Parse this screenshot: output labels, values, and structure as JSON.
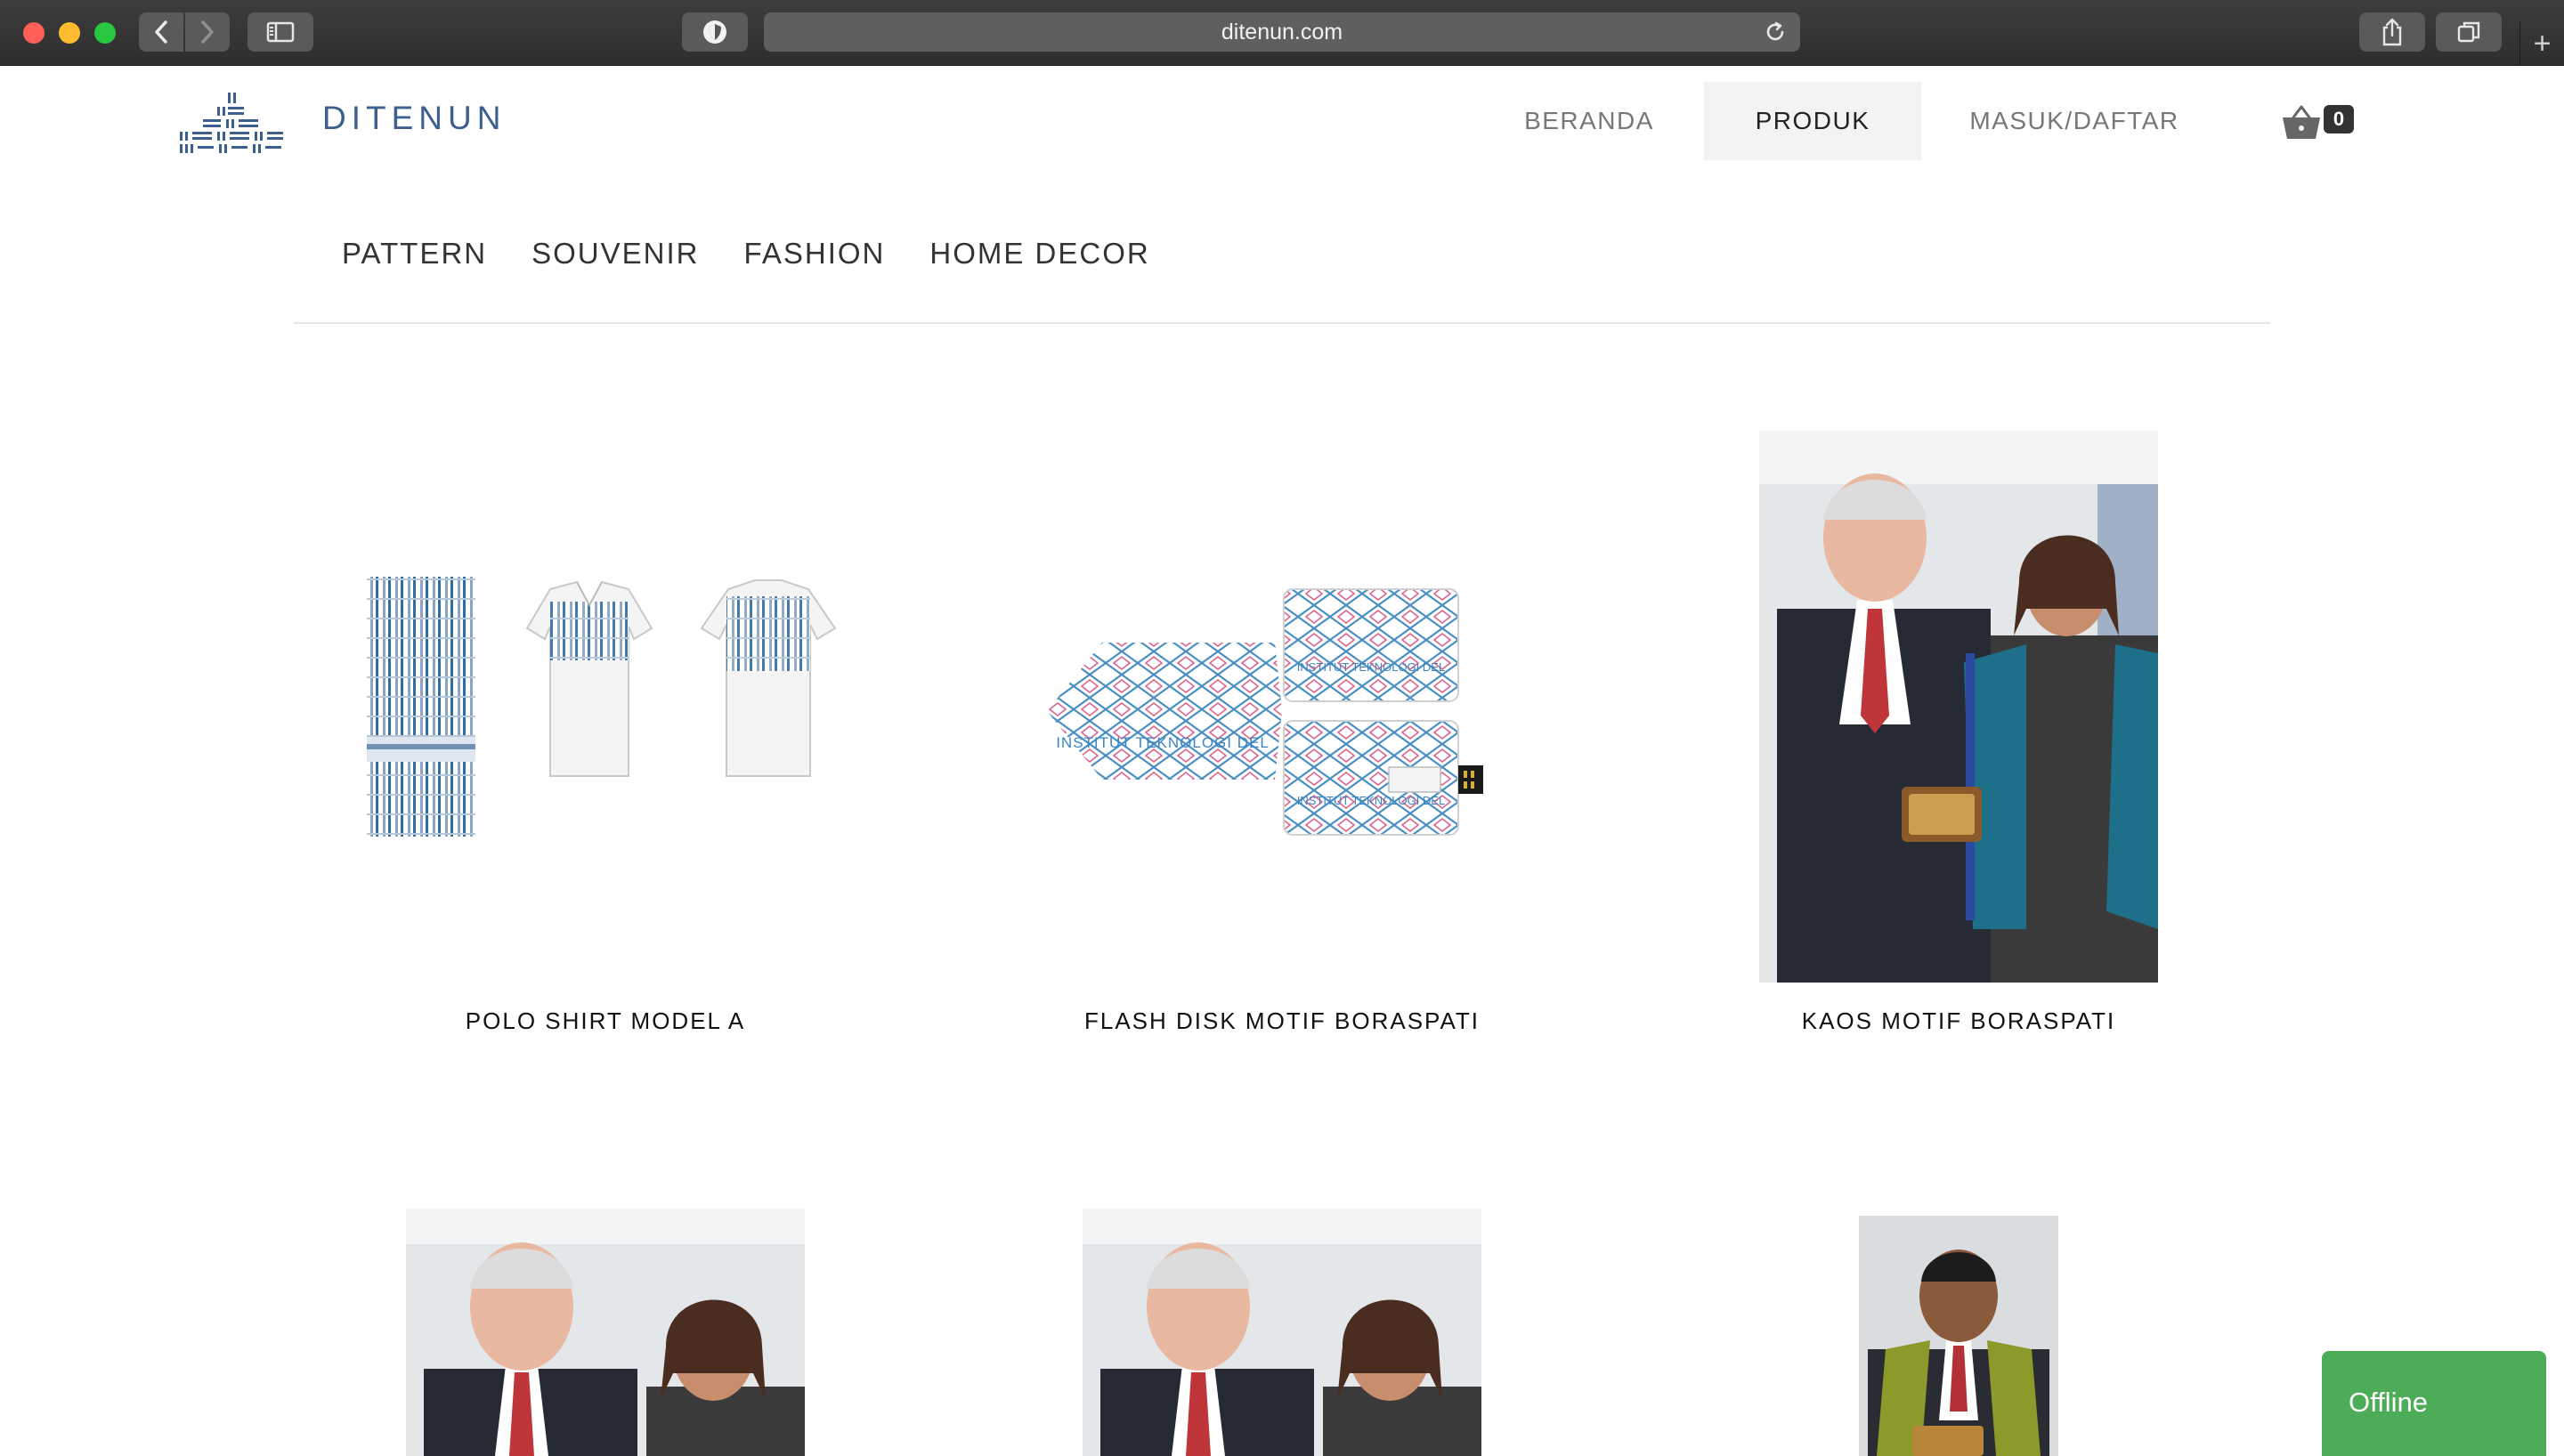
{
  "browser": {
    "url": "ditenun.com",
    "new_tab_glyph": "+",
    "icons": [
      "back-icon",
      "forward-icon",
      "sidebar-icon",
      "privacy-shield-icon",
      "reload-icon",
      "share-icon",
      "tabs-overview-icon"
    ]
  },
  "header": {
    "brand": "DITENUN",
    "nav": [
      {
        "label": "BERANDA"
      },
      {
        "label": "PRODUK",
        "active": true
      },
      {
        "label": "MASUK/DAFTAR"
      }
    ],
    "cart_count": "0"
  },
  "categories": [
    "PATTERN",
    "SOUVENIR",
    "FASHION",
    "HOME DECOR"
  ],
  "products": [
    {
      "title": "POLO SHIRT MODEL A"
    },
    {
      "title": "FLASH DISK MOTIF BORASPATI"
    },
    {
      "title": "KAOS MOTIF BORASPATI"
    }
  ],
  "usb_card_text": "INSTITUT TEKNOLOGI DEL",
  "chat": {
    "status": "Offline"
  },
  "colors": {
    "brand": "#3c5f8e",
    "ulos_blue": "#1f7fb3",
    "chat_green": "#4cac57"
  }
}
